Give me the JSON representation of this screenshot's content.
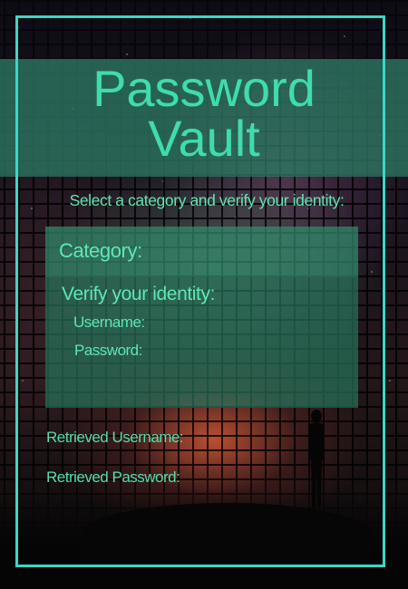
{
  "app": {
    "title_line1": "Password",
    "title_line2": "Vault",
    "instruction": "Select a category and verify your identity:"
  },
  "category": {
    "label": "Category:",
    "value": ""
  },
  "verify": {
    "heading": "Verify your identity:",
    "username_label": "Username:",
    "username_value": "",
    "password_label": "Password:",
    "password_value": ""
  },
  "results": {
    "username_label": "Retrieved Username:",
    "password_label": "Retrieved Password:"
  },
  "colors": {
    "accent": "#3bd7c6",
    "text": "#5ee8b4",
    "panel": "#328c6e"
  }
}
